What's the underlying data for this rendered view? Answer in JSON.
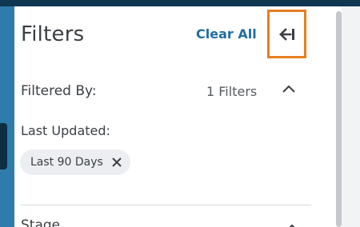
{
  "filters_panel": {
    "title": "Filters",
    "clear_all_label": "Clear All",
    "collapse_icon": "collapse-left-arrow-icon"
  },
  "filtered_by": {
    "label": "Filtered By:",
    "count_text": "1 Filters",
    "expanded": true
  },
  "last_updated": {
    "label": "Last Updated:",
    "chip_label": "Last 90 Days",
    "chip_remove_icon": "close-icon"
  },
  "stage": {
    "label": "Stage",
    "expanded": true
  },
  "colors": {
    "accent_link": "#1f6ea1",
    "highlight_border": "#e87d21",
    "header_bar": "#0f3752",
    "left_rail": "#2f7bab"
  }
}
